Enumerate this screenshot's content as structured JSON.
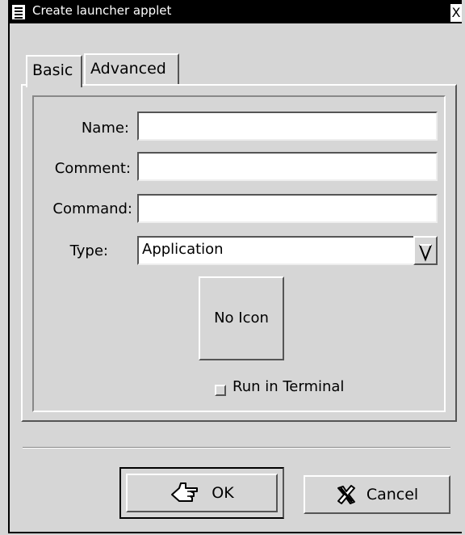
{
  "window": {
    "title": "Create launcher applet",
    "close_glyph": "X"
  },
  "tabs": [
    {
      "label": "Basic",
      "active": true
    },
    {
      "label": "Advanced",
      "active": false
    }
  ],
  "form": {
    "name_label": "Name:",
    "name_value": "",
    "comment_label": "Comment:",
    "comment_value": "",
    "command_label": "Command:",
    "command_value": "",
    "type_label": "Type:",
    "type_value": "Application",
    "icon_button_label": "No Icon",
    "run_in_terminal_label": "Run in Terminal",
    "run_in_terminal_checked": false
  },
  "buttons": {
    "ok_label": "OK",
    "ok_icon": "ok-hand-icon",
    "cancel_label": "Cancel",
    "cancel_icon": "cancel-x-icon"
  }
}
